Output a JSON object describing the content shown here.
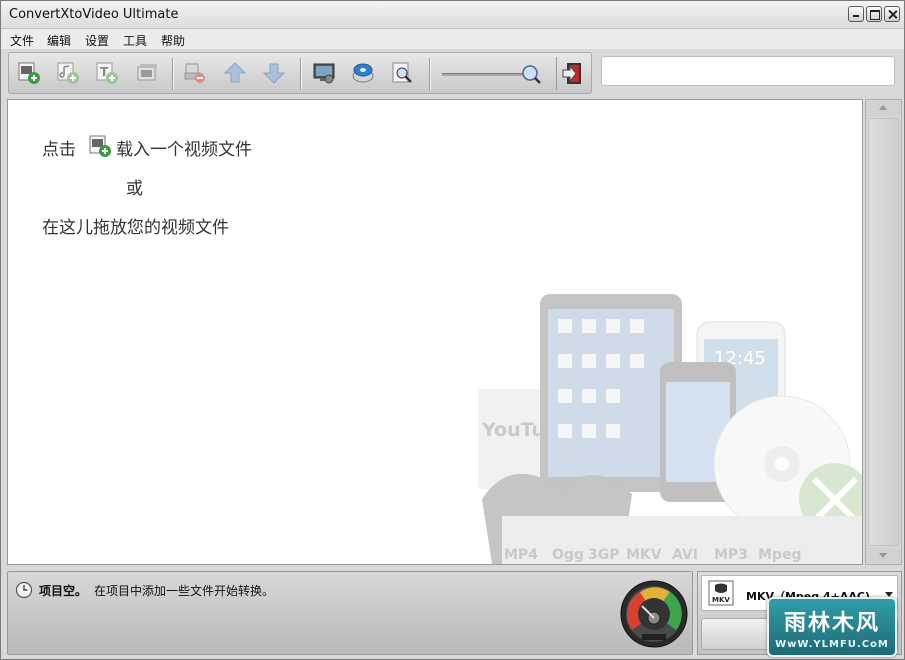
{
  "window": {
    "title": "ConvertXtoVideo Ultimate"
  },
  "menu": [
    "文件",
    "编辑",
    "设置",
    "工具",
    "帮助"
  ],
  "toolbar": {
    "buttons": [
      "add-video-icon",
      "add-audio-icon",
      "add-subtitle-icon",
      "add-chapter-icon",
      "remove-icon",
      "move-up-icon",
      "move-down-icon",
      "preview-icon",
      "burn-disc-icon",
      "zoom-preview-icon"
    ],
    "zoom_icon": "zoom-icon",
    "exit_icon": "exit-icon"
  },
  "search": {
    "value": "",
    "placeholder": ""
  },
  "content": {
    "line1_prefix": "点击",
    "line1_suffix": "载入一个视频文件",
    "line2": "或",
    "line3": "在这儿拖放您的视频文件",
    "art_labels": [
      "MP4",
      "Ogg",
      "3GP",
      "MKV",
      "AVI",
      "MP3",
      "Mpeg"
    ],
    "youtube": "YouTube",
    "phone_time": "12:45"
  },
  "status": {
    "title": "项目空。",
    "text": "在项目中添加一些文件开始转换。"
  },
  "profile": {
    "label": "MKV（Mpeg 4+AAC)",
    "icon": "mkv-icon"
  },
  "watermark": {
    "main": "雨林木风",
    "url": "WwW.YLMFU.CoM"
  },
  "colors": {
    "background": "#d9d9d9",
    "content": "#ffffff",
    "watermark": "#2f9ea8",
    "exit_red": "#c62828",
    "gauge_red": "#d9412e",
    "gauge_green": "#3da54a"
  }
}
